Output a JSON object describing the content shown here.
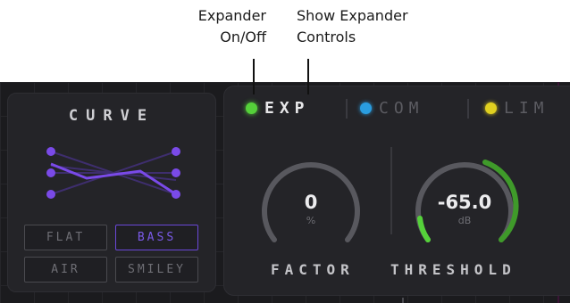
{
  "callouts": {
    "expander_onoff": [
      "Expander",
      "On/Off"
    ],
    "show_expander_controls": [
      "Show Expander",
      "Controls"
    ]
  },
  "curve": {
    "title": "CURVE",
    "buttons": [
      {
        "label": "FLAT",
        "active": false
      },
      {
        "label": "BASS",
        "active": true
      },
      {
        "label": "AIR",
        "active": false
      },
      {
        "label": "SMILEY",
        "active": false
      }
    ]
  },
  "dynamics": {
    "tabs": [
      {
        "label": "EXP",
        "color": "#55d13a",
        "active": true
      },
      {
        "label": "COM",
        "color": "#2a9de0",
        "active": false
      },
      {
        "label": "LIM",
        "color": "#e0d020",
        "active": false
      }
    ],
    "factor": {
      "value": "0",
      "unit": "%",
      "label": "FACTOR"
    },
    "threshold": {
      "value": "-65.0",
      "unit": "dB",
      "label": "THRESHOLD"
    }
  },
  "colors": {
    "accent_purple": "#7a4ae8",
    "exp_green": "#55d13a",
    "com_blue": "#2a9de0",
    "lim_yellow": "#e0d020"
  }
}
